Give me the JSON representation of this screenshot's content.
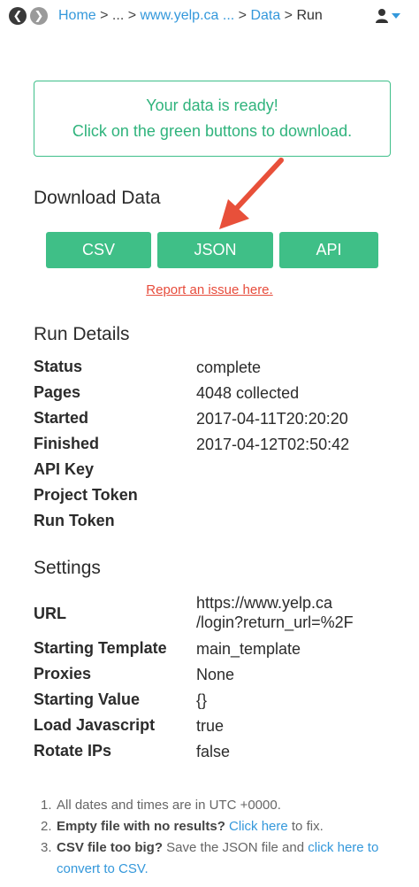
{
  "nav": {
    "back_glyph": "❮",
    "forward_glyph": "❯",
    "crumb_home": "Home",
    "crumb_sep1": " > ",
    "crumb_ellipsis": "...",
    "crumb_sep2": " > ",
    "crumb_site": "www.yelp.ca ...",
    "crumb_sep3": " > ",
    "crumb_data": "Data",
    "crumb_sep4": " > ",
    "crumb_current": "Run"
  },
  "ready": {
    "line1": "Your data is ready!",
    "line2": "Click on the green buttons to download."
  },
  "download": {
    "heading": "Download Data",
    "buttons": [
      "CSV",
      "JSON",
      "API"
    ],
    "report_link": "Report an issue here."
  },
  "run_details": {
    "heading": "Run Details",
    "rows": [
      {
        "label": "Status",
        "value": "complete"
      },
      {
        "label": "Pages",
        "value": "4048 collected"
      },
      {
        "label": "Started",
        "value": "2017-04-11T20:20:20"
      },
      {
        "label": "Finished",
        "value": "2017-04-12T02:50:42"
      },
      {
        "label": "API Key",
        "value": ""
      },
      {
        "label": "Project Token",
        "value": ""
      },
      {
        "label": "Run Token",
        "value": ""
      }
    ]
  },
  "settings": {
    "heading": "Settings",
    "url_label": "URL",
    "url_line1": "https://www.yelp.ca",
    "url_line2": "/login?return_url=%2F",
    "rows": [
      {
        "label": "Starting Template",
        "value": "main_template"
      },
      {
        "label": "Proxies",
        "value": "None"
      },
      {
        "label": "Starting Value",
        "value": "{}"
      },
      {
        "label": "Load Javascript",
        "value": "true"
      },
      {
        "label": "Rotate IPs",
        "value": "false"
      }
    ]
  },
  "notes": {
    "n1": "1.",
    "note1": "All dates and times are in UTC +0000.",
    "n2": "2.",
    "note2_bold": "Empty file with no results?",
    "note2_link": "Click here",
    "note2_rest": " to fix.",
    "n3": "3.",
    "note3_bold": "CSV file too big?",
    "note3_text": " Save the JSON file and ",
    "note3_link": "click here to convert to CSV."
  },
  "colors": {
    "accent_green": "#3fbf87",
    "link_blue": "#3498db",
    "report_red": "#e74c3c",
    "arrow_red": "#e8503a"
  },
  "icons": [
    "back-icon",
    "forward-icon",
    "user-icon",
    "caret-down-icon",
    "annotation-arrow"
  ]
}
